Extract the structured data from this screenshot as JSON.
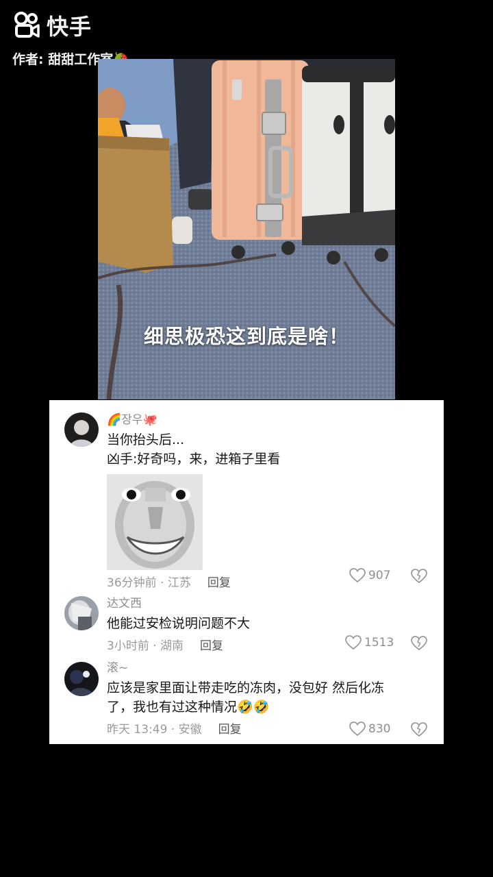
{
  "watermark": {
    "brand": "快手",
    "author": "作者: 甜甜工作室🍓"
  },
  "video": {
    "subtitle": "细思极恐这到底是啥！"
  },
  "comments": [
    {
      "name": "🌈장우🐙",
      "lines": [
        "当你抬头后...",
        "凶手:好奇吗，来，进箱子里看"
      ],
      "time_location": "36分钟前 · 江苏",
      "reply": "回复",
      "likes": "907",
      "has_image": true
    },
    {
      "name": "达文西",
      "lines": [
        "他能过安检说明问题不大"
      ],
      "time_location": "3小时前 · 湖南",
      "reply": "回复",
      "likes": "1513",
      "has_image": false
    },
    {
      "name": "滚~",
      "lines": [
        "应该是家里面让带走吃的冻肉，没包好 然后化冻",
        "了，我也有过这种情况🤣🤣"
      ],
      "time_location": "昨天 13:49 · 安徽",
      "reply": "回复",
      "likes": "830",
      "has_image": false
    }
  ],
  "colors": {
    "background": "#000000",
    "card": "#ffffff",
    "meta": "#9a9a9a"
  },
  "icons": {
    "like": "heart-outline-icon",
    "dislike": "broken-heart-icon",
    "brand": "kuaishou-logo-icon"
  }
}
